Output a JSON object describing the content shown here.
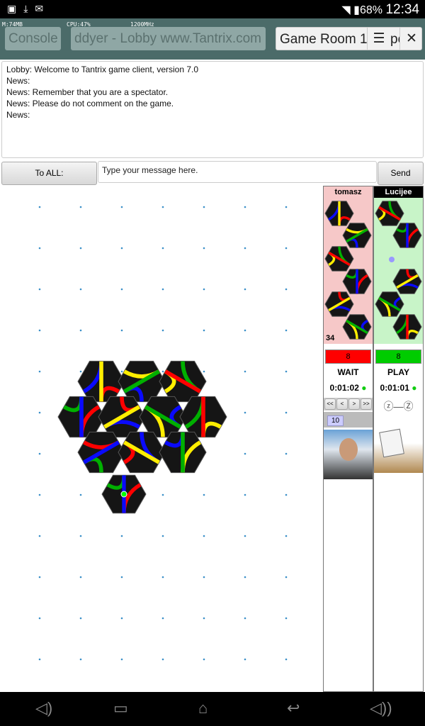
{
  "statusbar": {
    "battery": "68%",
    "time": "12:34",
    "icons": [
      "image-icon",
      "download-icon",
      "clipboard-check-icon",
      "wifi-icon",
      "battery-icon"
    ]
  },
  "header": {
    "memory": "M:74MB",
    "cpu": "CPU:47%",
    "freq": "1200MHz",
    "tabs": [
      {
        "label": "Console"
      },
      {
        "label": "ddyer - Lobby www.Tantrix.com"
      },
      {
        "label": "Game Room 1"
      }
    ],
    "overflow_text": "pe"
  },
  "chat": {
    "lines": [
      "Lobby: Welcome to Tantrix game client, version 7.0",
      "News:",
      "News: Remember that you are a spectator.",
      "News: Please do not comment on the game.",
      "News:"
    ]
  },
  "compose": {
    "to_label": "To ALL:",
    "placeholder": "Type your message here.",
    "send_label": "Send"
  },
  "players": [
    {
      "name": "tomasz",
      "count": "34",
      "score": "8",
      "score_color": "#ff0000",
      "state": "WAIT",
      "time": "0:01:02",
      "panel_color": "#f6c8c8"
    },
    {
      "name": "Lucijee",
      "score": "8",
      "score_color": "#00cc00",
      "state": "PLAY",
      "time": "0:01:01",
      "panel_color": "#c8f4c8"
    }
  ],
  "controls": {
    "nav": [
      "<<",
      "<",
      ">",
      ">>"
    ],
    "move_number": "10"
  }
}
